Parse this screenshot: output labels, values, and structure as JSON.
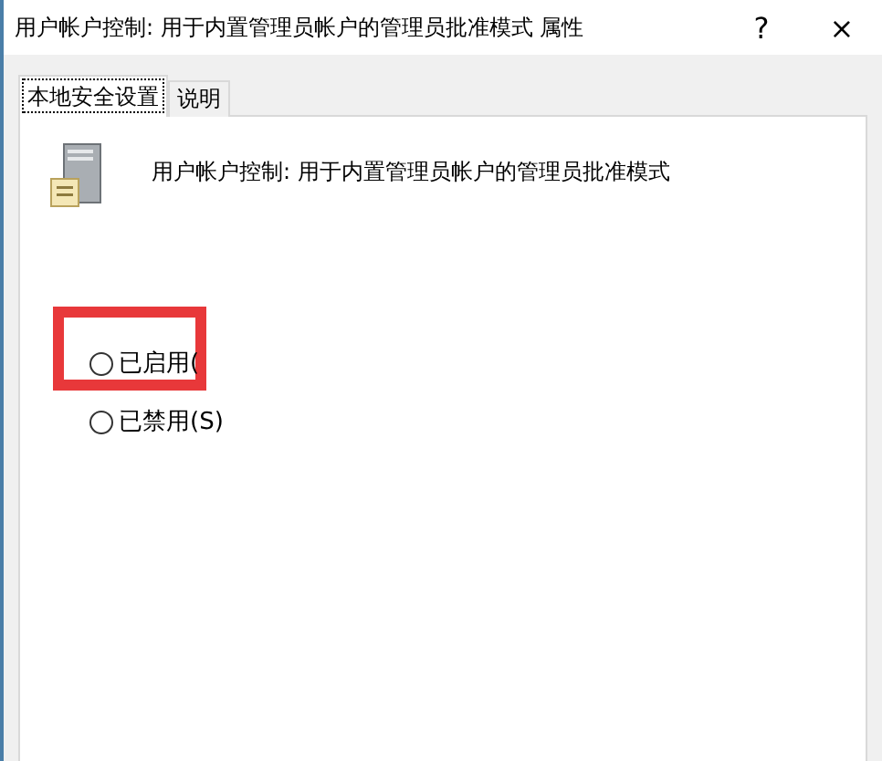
{
  "window": {
    "title": "用户帐户控制: 用于内置管理员帐户的管理员批准模式 属性",
    "help": "?",
    "close": "×"
  },
  "tabs": [
    {
      "label": "本地安全设置",
      "selected": true
    },
    {
      "label": "说明",
      "selected": false
    }
  ],
  "policy": {
    "name": "用户帐户控制: 用于内置管理员帐户的管理员批准模式"
  },
  "highlight": {
    "kind": "frame"
  },
  "options": [
    {
      "label": "已启用(",
      "selected": false
    },
    {
      "label": "已禁用(S)",
      "selected": false
    }
  ]
}
